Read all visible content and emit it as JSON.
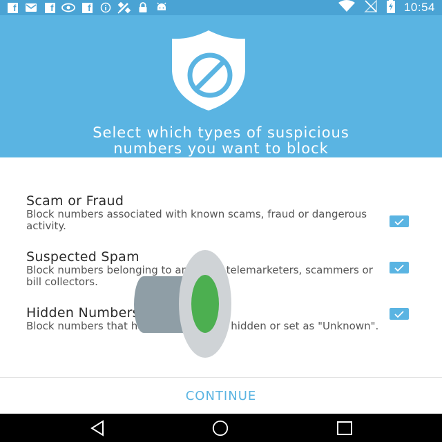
{
  "status_bar": {
    "time": "10:54",
    "notification_icons": [
      "facebook-icon",
      "message-icon",
      "facebook-icon",
      "nvidia-icon",
      "facebook-icon",
      "info-icon",
      "satellite-icon",
      "lock-icon",
      "android-icon"
    ],
    "system_icons": [
      "wifi-icon",
      "no-sim-icon",
      "battery-charging-icon"
    ]
  },
  "header": {
    "icon": "shield-block-icon",
    "title": "Select which types of suspicious\nnumbers you want to block"
  },
  "options": [
    {
      "title": "Scam or Fraud",
      "description": "Block numbers associated with known scams, fraud or dangerous activity.",
      "checked": true
    },
    {
      "title": "Suspected Spam",
      "description": "Block numbers belonging to annoying telemarketers, scammers or bill collectors.",
      "checked": true
    },
    {
      "title": "Hidden Numbers",
      "description": "Block numbers that have their number hidden or set as \"Unknown\".",
      "checked": true
    }
  ],
  "continue_label": "CONTINUE",
  "nav_bar": {
    "buttons": [
      "back-icon",
      "home-icon",
      "recents-icon"
    ]
  },
  "colors": {
    "accent": "#5ab4e2",
    "status_bar": "#4aa3d4",
    "nav_bar": "#000000"
  }
}
